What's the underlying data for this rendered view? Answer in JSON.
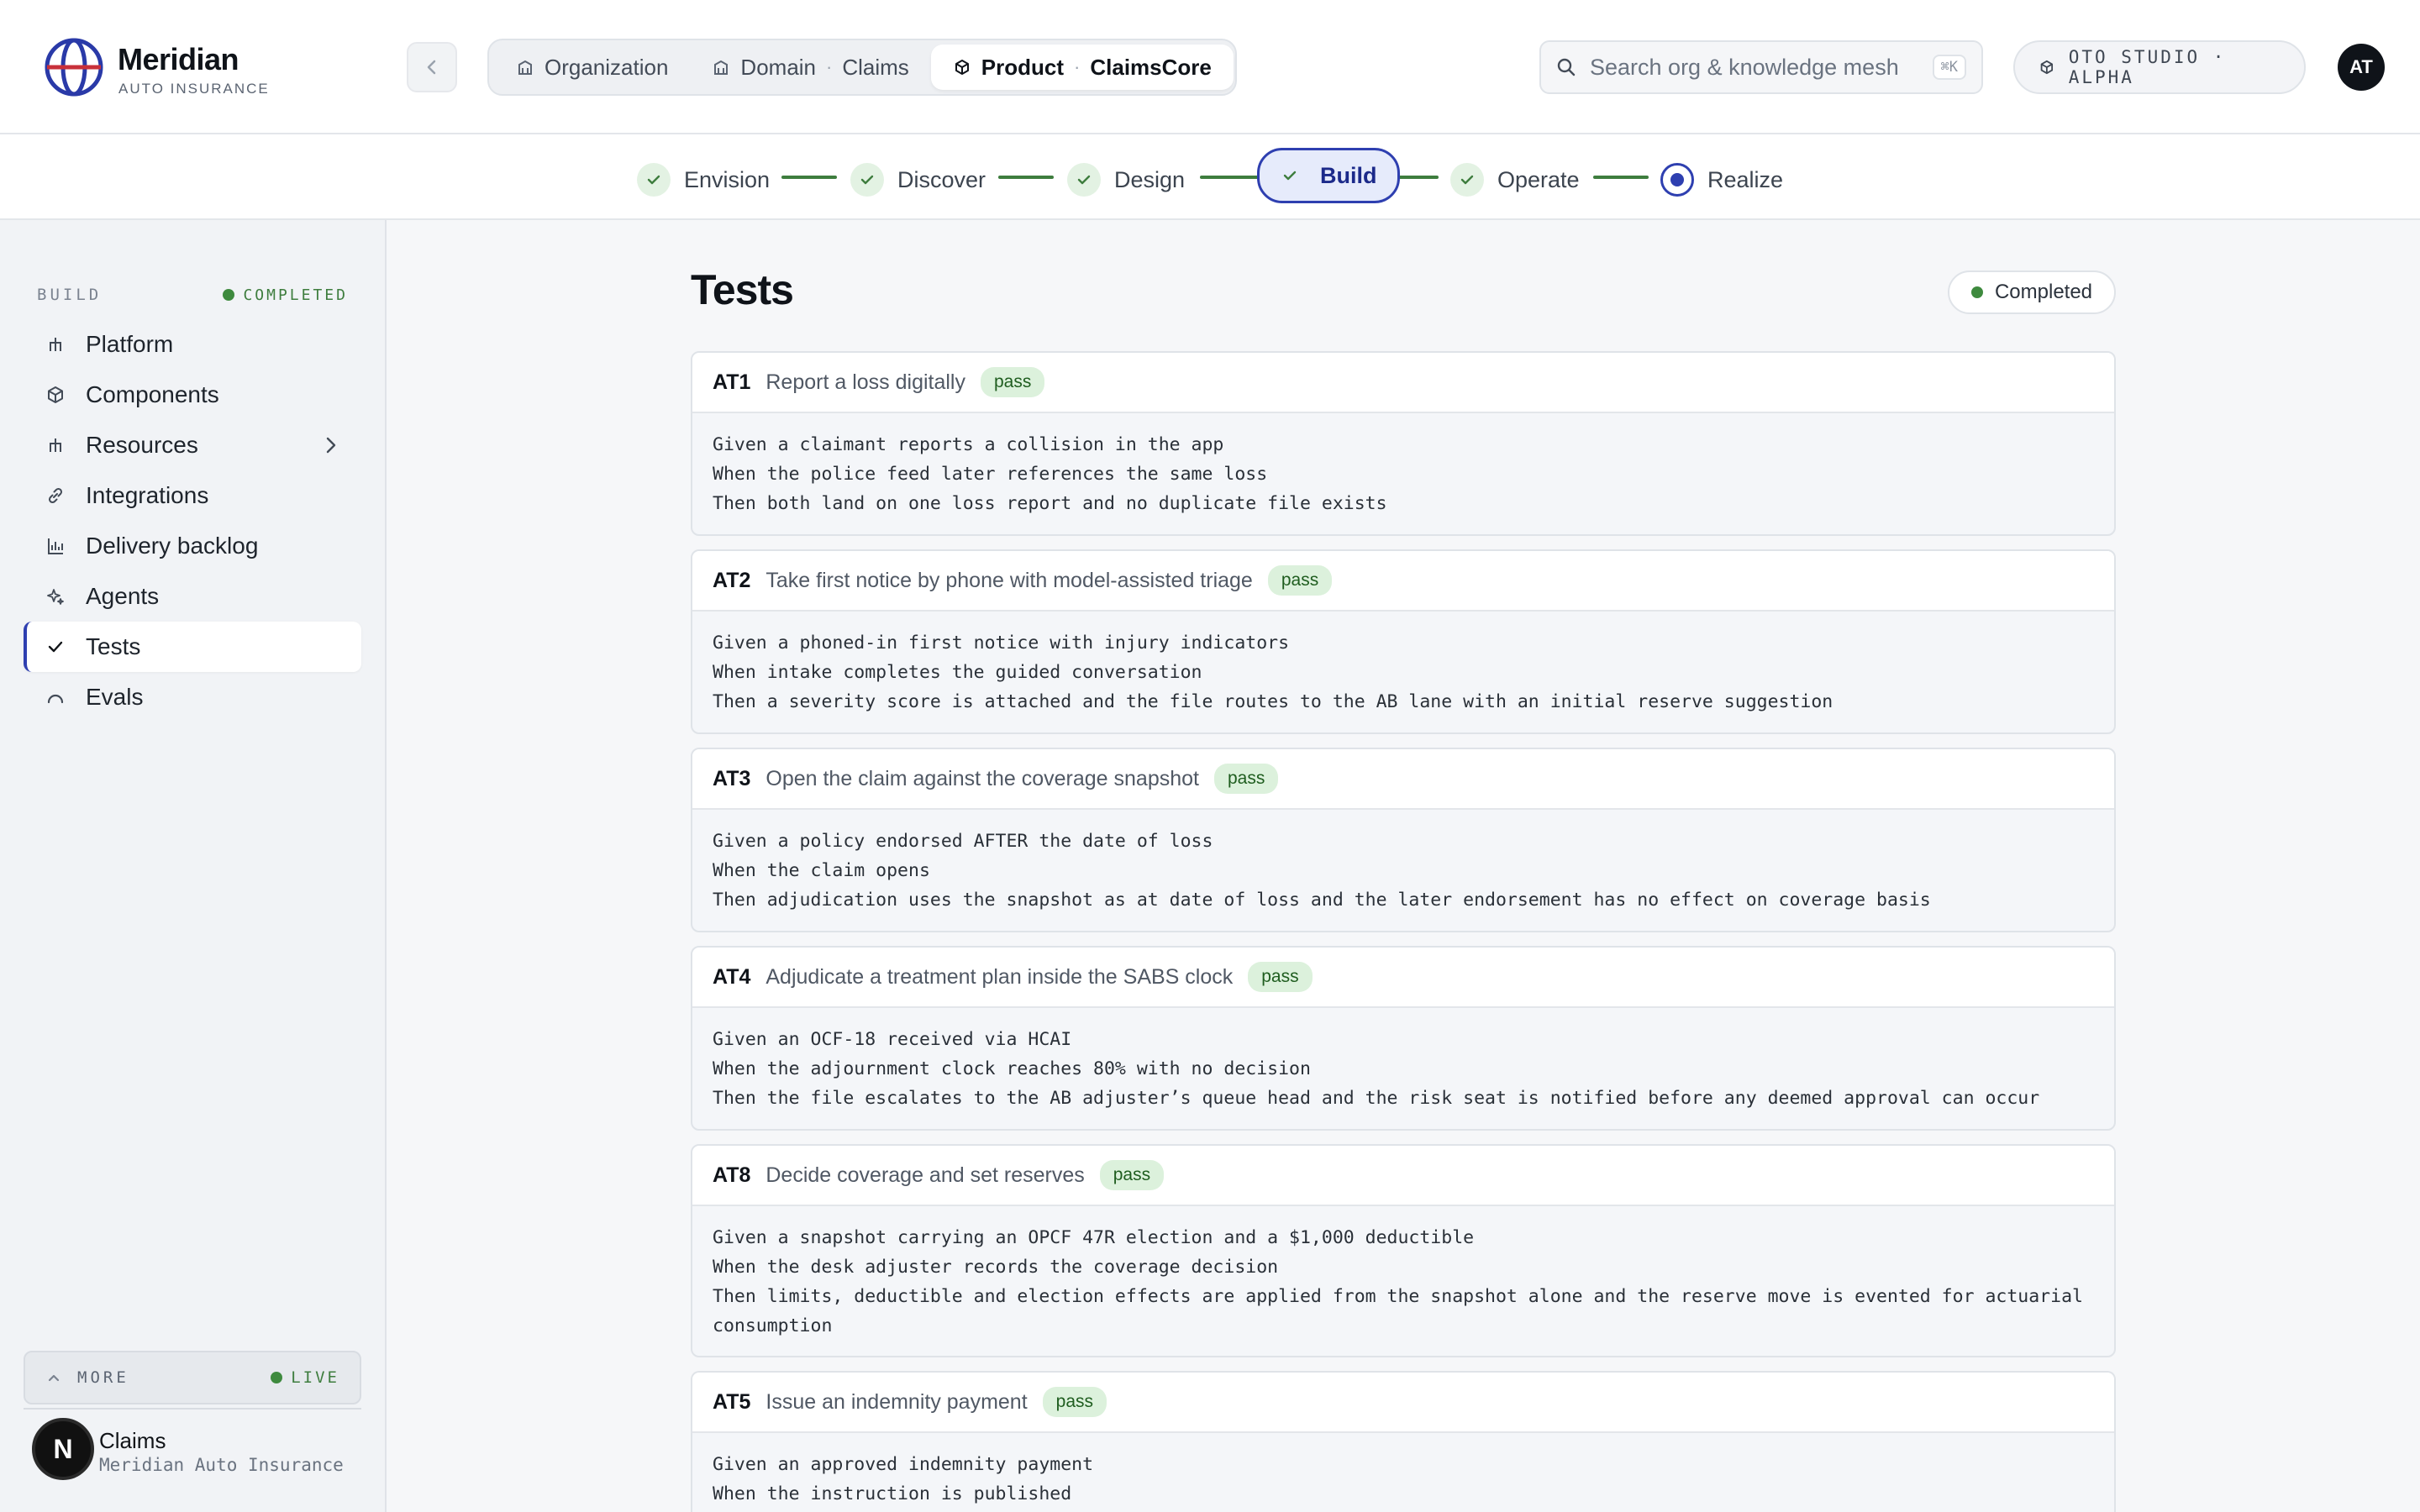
{
  "brand": {
    "name": "Meridian",
    "subtitle": "AUTO INSURANCE"
  },
  "breadcrumbs": [
    {
      "label": "Organization"
    },
    {
      "label": "Domain",
      "value": "Claims"
    },
    {
      "label": "Product",
      "value": "ClaimsCore"
    }
  ],
  "search": {
    "placeholder": "Search org & knowledge mesh",
    "shortcut": "⌘K"
  },
  "studio": {
    "label": "OTO STUDIO · ALPHA"
  },
  "user": {
    "initials": "AT"
  },
  "stepper": [
    "Envision",
    "Discover",
    "Design",
    "Build",
    "Operate",
    "Realize"
  ],
  "sidebar": {
    "section": "BUILD",
    "status": "COMPLETED",
    "items": [
      "Platform",
      "Components",
      "Resources",
      "Integrations",
      "Delivery backlog",
      "Agents",
      "Tests",
      "Evals"
    ],
    "more": "MORE",
    "live": "LIVE"
  },
  "account": {
    "name": "Claims",
    "org": "Meridian Auto Insurance",
    "avatar": "N"
  },
  "page": {
    "title": "Tests",
    "status": "Completed"
  },
  "tests": [
    {
      "id": "AT1",
      "title": "Report a loss digitally",
      "result": "pass",
      "given": "Given a claimant reports a collision in the app",
      "when": "When the police feed later references the same loss",
      "then": "Then both land on one loss report and no duplicate file exists"
    },
    {
      "id": "AT2",
      "title": "Take first notice by phone with model-assisted triage",
      "result": "pass",
      "given": "Given a phoned-in first notice with injury indicators",
      "when": "When intake completes the guided conversation",
      "then": "Then a severity score is attached and the file routes to the AB lane with an initial reserve suggestion"
    },
    {
      "id": "AT3",
      "title": "Open the claim against the coverage snapshot",
      "result": "pass",
      "given": "Given a policy endorsed AFTER the date of loss",
      "when": "When the claim opens",
      "then": "Then adjudication uses the snapshot as at date of loss and the later endorsement has no effect on coverage basis"
    },
    {
      "id": "AT4",
      "title": "Adjudicate a treatment plan inside the SABS clock",
      "result": "pass",
      "given": "Given an OCF-18 received via HCAI",
      "when": "When the adjournment clock reaches 80% with no decision",
      "then": "Then the file escalates to the AB adjuster’s queue head and the risk seat is notified before any deemed approval can occur"
    },
    {
      "id": "AT8",
      "title": "Decide coverage and set reserves",
      "result": "pass",
      "given": "Given a snapshot carrying an OPCF 47R election and a $1,000 deductible",
      "when": "When the desk adjuster records the coverage decision",
      "then": "Then limits, deductible and election effects are applied from the snapshot alone and the reserve move is evented for actuarial consumption"
    },
    {
      "id": "AT5",
      "title": "Issue an indemnity payment",
      "result": "pass",
      "given": "Given an approved indemnity payment",
      "when": "When the instruction is published",
      "then": ""
    }
  ],
  "colors": {
    "accent": "#2e3fb0",
    "success": "#3e7d3e",
    "pass_bg": "#dcf1dc"
  }
}
